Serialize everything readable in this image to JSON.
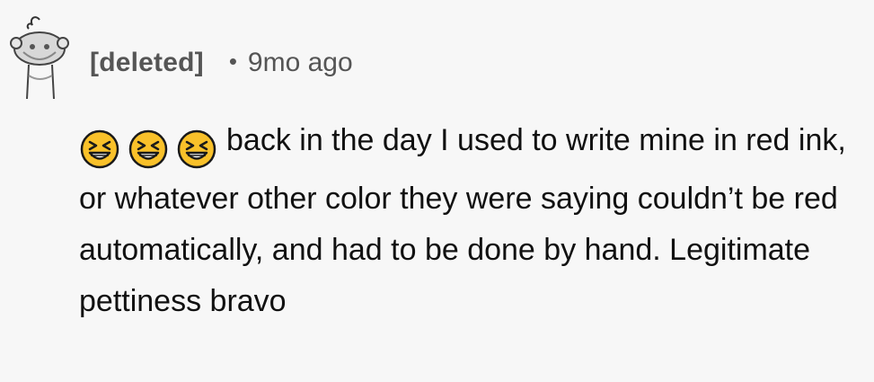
{
  "comment": {
    "author": "[deleted]",
    "separator": "•",
    "timestamp": "9mo ago",
    "emojis": [
      "laughing-face-icon",
      "laughing-face-icon",
      "laughing-face-icon"
    ],
    "text": "back in the day I used to write mine in red ink, or whatever other color they were saying couldn’t be red automatically, and had to be done by hand. Legitimate pettiness bravo"
  },
  "colors": {
    "background": "#f7f7f7",
    "meta_text": "#555555",
    "body_text": "#111111",
    "emoji_fill": "#f9c12a",
    "emoji_outline": "#1a1a1a"
  }
}
